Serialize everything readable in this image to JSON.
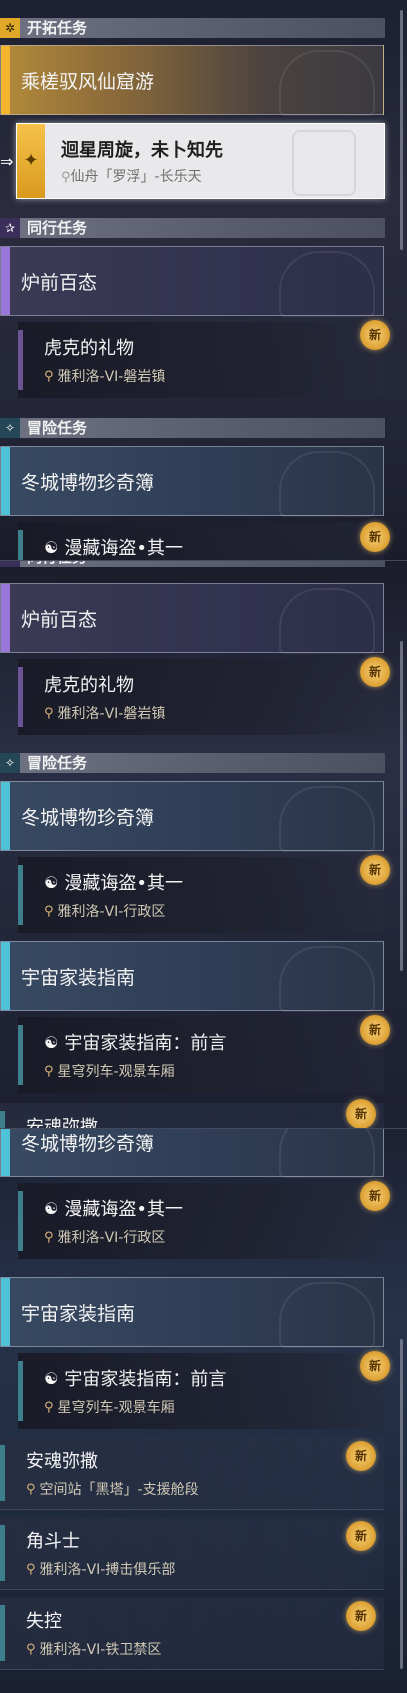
{
  "icons": {
    "trailblaze": "star-burst-icon",
    "companion": "star-icon",
    "adventure": "sparkle-icon",
    "pin": "map-pin-icon",
    "quest": "quest-scroll-icon",
    "selected_arrow": "arrow-right-icon"
  },
  "labels": {
    "new": "新"
  },
  "categories": {
    "trailblaze": "开拓任务",
    "companion": "同行任务",
    "adventure": "冒险任务"
  },
  "trailblaze": {
    "card_title": "乘槎驭风仙窟游",
    "selected_title": "迴星周旋，未卜知先",
    "selected_location": "仙舟「罗浮」-长乐天"
  },
  "companion": {
    "card_title": "炉前百态",
    "sub_title": "虎克的礼物",
    "sub_location": "雅利洛-VI-磐岩镇"
  },
  "adventure": {
    "card1_title": "冬城博物珍奇簿",
    "sub1_title": "漫藏诲盗•其一",
    "sub1_location": "雅利洛-VI-行政区",
    "card2_title": "宇宙家装指南",
    "sub2_title": "宇宙家装指南：前言",
    "sub2_location": "星穹列车-观景车厢",
    "quests": [
      {
        "title": "安魂弥撒",
        "location": "空间站「黑塔」-支援舱段"
      },
      {
        "title": "角斗士",
        "location": "雅利洛-VI-搏击俱乐部"
      },
      {
        "title": "失控",
        "location": "雅利洛-VI-铁卫禁区"
      }
    ]
  },
  "colors": {
    "gold": "#f1b42c",
    "purple": "#9a76d8",
    "cyan": "#4fc2d8",
    "new_badge": "#e0a63a"
  }
}
